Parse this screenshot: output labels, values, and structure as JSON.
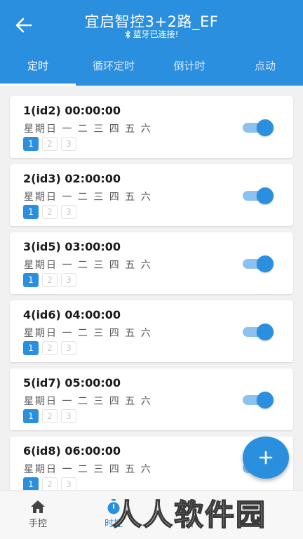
{
  "header": {
    "title": "宜启智控3+2路_EF",
    "subtitle": "蓝牙已连接!"
  },
  "tabs": [
    {
      "label": "定时",
      "active": true
    },
    {
      "label": "循环定时",
      "active": false
    },
    {
      "label": "倒计时",
      "active": false
    },
    {
      "label": "点动",
      "active": false
    }
  ],
  "timers": [
    {
      "title": "1(id2) 00:00:00",
      "days": "星期日 一 二 三 四 五 六",
      "chips": [
        "1",
        "2",
        "3"
      ],
      "active_chip": "1",
      "enabled": true
    },
    {
      "title": "2(id3) 02:00:00",
      "days": "星期日 一 二 三 四 五 六",
      "chips": [
        "1",
        "2",
        "3"
      ],
      "active_chip": "1",
      "enabled": true
    },
    {
      "title": "3(id5) 03:00:00",
      "days": "星期日 一 二 三 四 五 六",
      "chips": [
        "1",
        "2",
        "3"
      ],
      "active_chip": "1",
      "enabled": true
    },
    {
      "title": "4(id6) 04:00:00",
      "days": "星期日 一 二 三 四 五 六",
      "chips": [
        "1",
        "2",
        "3"
      ],
      "active_chip": "1",
      "enabled": true
    },
    {
      "title": "5(id7) 05:00:00",
      "days": "星期日 一 二 三 四 五 六",
      "chips": [
        "1",
        "2",
        "3"
      ],
      "active_chip": "1",
      "enabled": true
    },
    {
      "title": "6(id8) 06:00:00",
      "days": "星期日 一 二 三 四 五 六",
      "chips": [
        "1",
        "2",
        "3"
      ],
      "active_chip": "1",
      "enabled": true
    }
  ],
  "bottom_nav": [
    {
      "label": "手控",
      "icon": "home-icon",
      "active": false
    },
    {
      "label": "时控",
      "icon": "stopwatch-icon",
      "active": true
    },
    {
      "label": "自",
      "icon": "grid-icon",
      "active": false
    },
    {
      "label": "",
      "icon": "",
      "active": false
    }
  ],
  "watermark": "人人软件园",
  "colors": {
    "primary": "#2b8fe0",
    "toggle_track": "#8cc2ef",
    "background": "#f1f1f1"
  }
}
